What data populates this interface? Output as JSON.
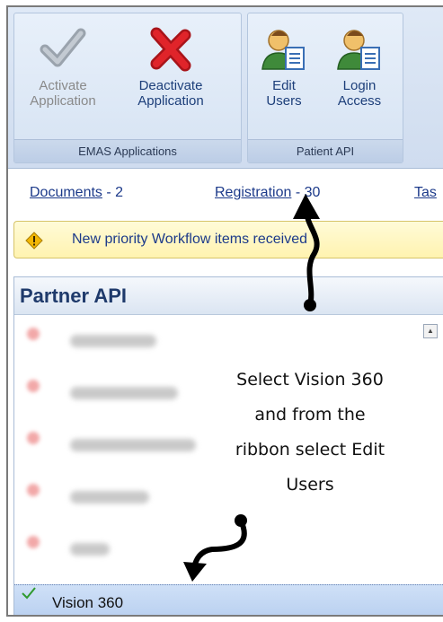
{
  "ribbon": {
    "groups": [
      {
        "label": "EMAS Applications",
        "buttons": [
          {
            "line1": "Activate",
            "line2": "Application",
            "icon": "checkmark-icon",
            "enabled": false
          },
          {
            "line1": "Deactivate",
            "line2": "Application",
            "icon": "red-x-icon",
            "enabled": true
          }
        ]
      },
      {
        "label": "Patient API",
        "buttons": [
          {
            "line1": "Edit",
            "line2": "Users",
            "icon": "user-document-icon",
            "enabled": true
          },
          {
            "line1": "Login",
            "line2": "Access",
            "icon": "user-document-icon",
            "enabled": true
          }
        ]
      }
    ]
  },
  "links": [
    {
      "label": "Documents",
      "count": "- 2"
    },
    {
      "label": "Registration",
      "count": "- 30"
    },
    {
      "label": "Tas",
      "count": ""
    }
  ],
  "alert": {
    "icon": "warning-diamond-icon",
    "text": "New priority Workflow items received"
  },
  "panel": {
    "title": "Partner API",
    "selected_item": "Vision 360"
  },
  "annotation": {
    "lines": [
      "Select Vision 360",
      "and from the",
      "ribbon select Edit",
      "Users"
    ]
  },
  "colors": {
    "ribbon_bg": "#d6e3f3",
    "link": "#1c3a8a",
    "alert_bg": "#fff3b0",
    "selection": "#b9d0f0",
    "deactivate_red": "#e0242a"
  }
}
